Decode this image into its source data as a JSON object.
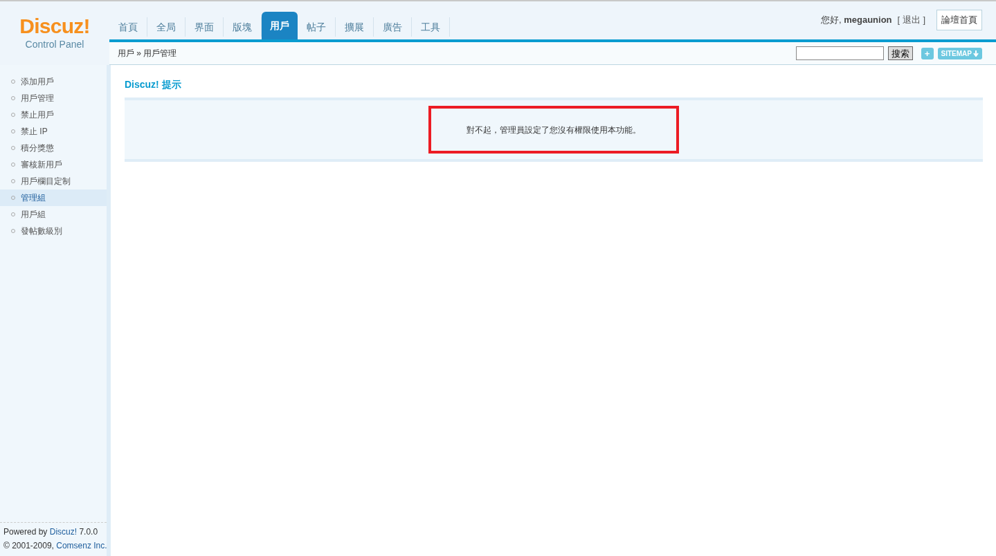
{
  "logo": {
    "name": "Discuz!",
    "subtitle": "Control Panel"
  },
  "tabs": [
    {
      "label": "首頁",
      "selected": false
    },
    {
      "label": "全局",
      "selected": false
    },
    {
      "label": "界面",
      "selected": false
    },
    {
      "label": "版塊",
      "selected": false
    },
    {
      "label": "用戶",
      "selected": true
    },
    {
      "label": "帖子",
      "selected": false
    },
    {
      "label": "擴展",
      "selected": false
    },
    {
      "label": "廣告",
      "selected": false
    },
    {
      "label": "工具",
      "selected": false
    }
  ],
  "user": {
    "greeting": "您好,",
    "name": "megaunion",
    "logout": "[ 退出 ]",
    "home_button": "論壇首頁"
  },
  "breadcrumb": {
    "section": "用戶",
    "separator": "»",
    "page": "用戶管理"
  },
  "search": {
    "button": "搜索",
    "plus": "+",
    "sitemap": "SITEMAP"
  },
  "sidebar": {
    "items": [
      {
        "label": "添加用戶",
        "selected": false
      },
      {
        "label": "用戶管理",
        "selected": false
      },
      {
        "label": "禁止用戶",
        "selected": false
      },
      {
        "label": "禁止 IP",
        "selected": false
      },
      {
        "label": "積分獎懲",
        "selected": false
      },
      {
        "label": "審核新用戶",
        "selected": false
      },
      {
        "label": "用戶欄目定制",
        "selected": false
      },
      {
        "label": "管理組",
        "selected": true
      },
      {
        "label": "用戶組",
        "selected": false
      },
      {
        "label": "發帖數級別",
        "selected": false
      }
    ]
  },
  "footer": {
    "powered": "Powered by",
    "product": "Discuz!",
    "version": "7.0.0",
    "copyright": "© 2001-2009,",
    "company": "Comsenz Inc."
  },
  "notice": {
    "title": "Discuz! 提示",
    "message": "對不起，管理員設定了您沒有權限使用本功能。",
    "highlighted": true
  }
}
